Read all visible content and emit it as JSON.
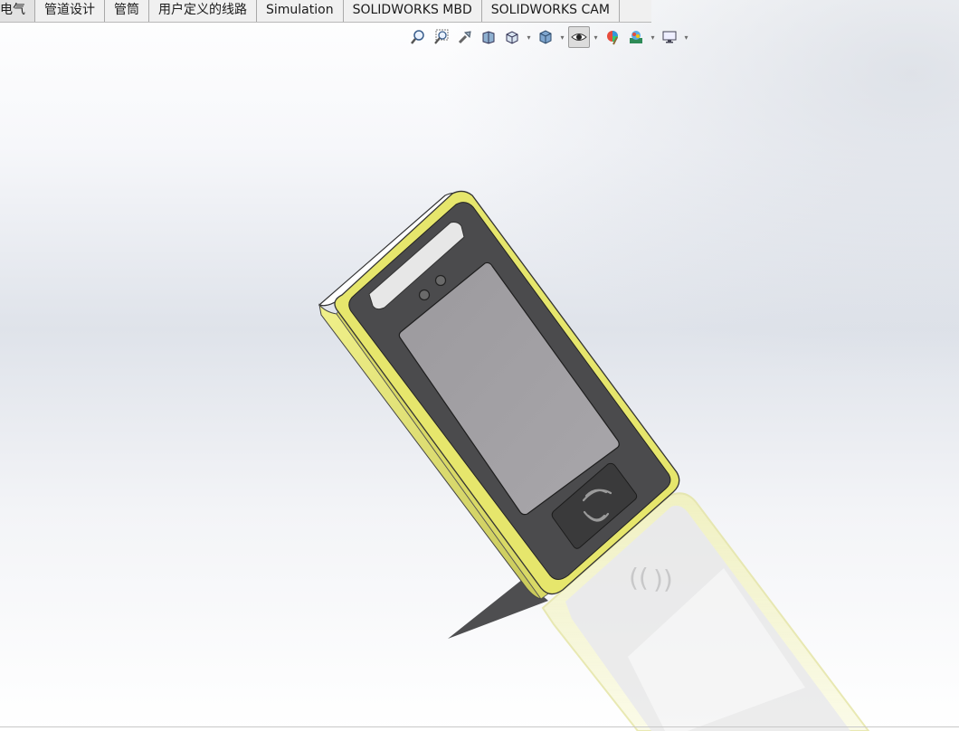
{
  "tabs": [
    {
      "label": "电气"
    },
    {
      "label": "管道设计"
    },
    {
      "label": "管筒"
    },
    {
      "label": "用户定义的线路"
    },
    {
      "label": "Simulation"
    },
    {
      "label": "SOLIDWORKS MBD"
    },
    {
      "label": "SOLIDWORKS CAM"
    }
  ],
  "hud_toolbar": [
    {
      "icon": "zoom-to-fit-icon",
      "active": false
    },
    {
      "icon": "zoom-to-area-icon",
      "active": false
    },
    {
      "icon": "previous-view-icon",
      "active": false
    },
    {
      "icon": "section-view-icon",
      "active": false
    },
    {
      "icon": "view-orientation-icon",
      "active": false,
      "dropdown": true
    },
    {
      "icon": "display-style-icon",
      "active": false,
      "dropdown": true
    },
    {
      "icon": "hide-show-items-icon",
      "active": true,
      "dropdown": true
    },
    {
      "icon": "edit-appearance-icon",
      "active": false
    },
    {
      "icon": "apply-scene-icon",
      "active": false,
      "dropdown": true
    },
    {
      "icon": "view-settings-icon",
      "active": false,
      "dropdown": true
    }
  ],
  "colors": {
    "frame_yellow": "#e7e76a",
    "frame_dark_yellow": "#b7b73a",
    "bezel": "#4a4a4a",
    "screen": "#9b9a9c",
    "ir_window": "#e8e8e8",
    "nfc_pad": "#3c3c3c"
  }
}
